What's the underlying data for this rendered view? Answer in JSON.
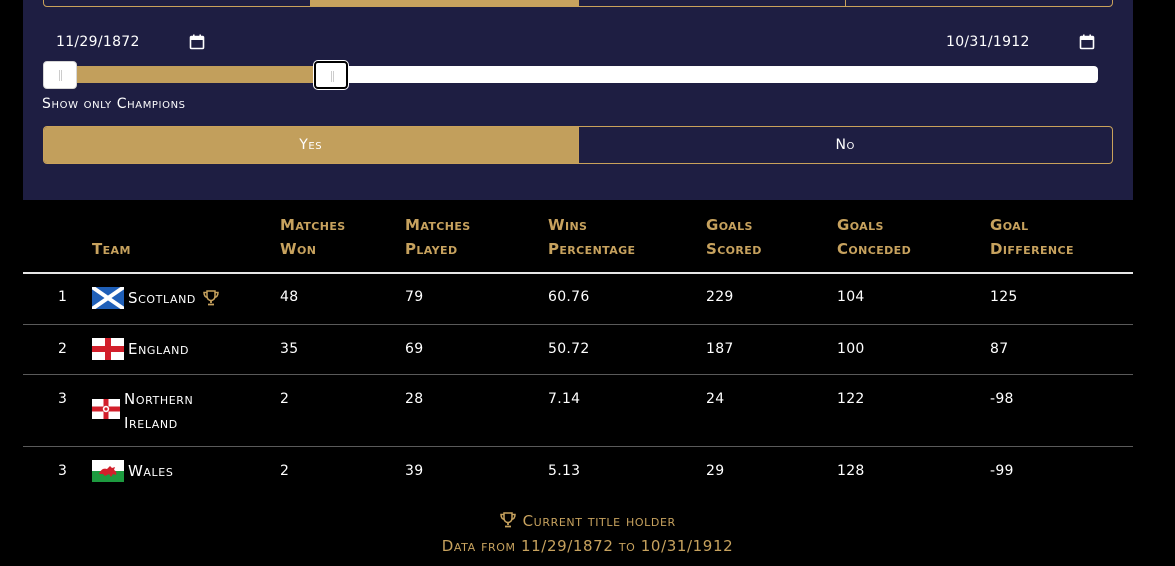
{
  "filters": {
    "tabs": [
      "",
      "",
      "",
      ""
    ],
    "active_tab": 1,
    "start_date": "11/29/1872",
    "end_date": "10/31/1912",
    "range_fraction": [
      0.0,
      0.265
    ],
    "show_only_champions_label": "Show only Champions",
    "champion_options": [
      "Yes",
      "No"
    ],
    "champion_selected": "Yes"
  },
  "table": {
    "headers": {
      "rank": "",
      "team": "Team",
      "matches_won": "Matches Won",
      "matches_played": "Matches Played",
      "wins_percentage": "Wins Percentage",
      "goals_scored": "Goals Scored",
      "goals_conceded": "Goals Conceded",
      "goal_difference": "Goal Difference"
    },
    "rows": [
      {
        "rank": "1",
        "team": "Scotland",
        "flag": "scotland-flag",
        "champion": true,
        "won": "48",
        "played": "79",
        "pct": "60.76",
        "scored": "229",
        "conceded": "104",
        "diff": "125"
      },
      {
        "rank": "2",
        "team": "England",
        "flag": "england-flag",
        "champion": false,
        "won": "35",
        "played": "69",
        "pct": "50.72",
        "scored": "187",
        "conceded": "100",
        "diff": "87"
      },
      {
        "rank": "3",
        "team": "Northern Ireland",
        "flag": "northern-ireland-flag",
        "champion": false,
        "won": "2",
        "played": "28",
        "pct": "7.14",
        "scored": "24",
        "conceded": "122",
        "diff": "-98"
      },
      {
        "rank": "3",
        "team": "Wales",
        "flag": "wales-flag",
        "champion": false,
        "won": "2",
        "played": "39",
        "pct": "5.13",
        "scored": "29",
        "conceded": "128",
        "diff": "-99"
      }
    ]
  },
  "footer": {
    "legend_icon": "trophy-icon",
    "legend_text": "Current title holder",
    "data_range_text": "Data from 11/29/1872 to 10/31/1912"
  },
  "colors": {
    "panel_bg": "#1e1e42",
    "accent_gold": "#c7a25e",
    "page_bg": "#000000"
  }
}
